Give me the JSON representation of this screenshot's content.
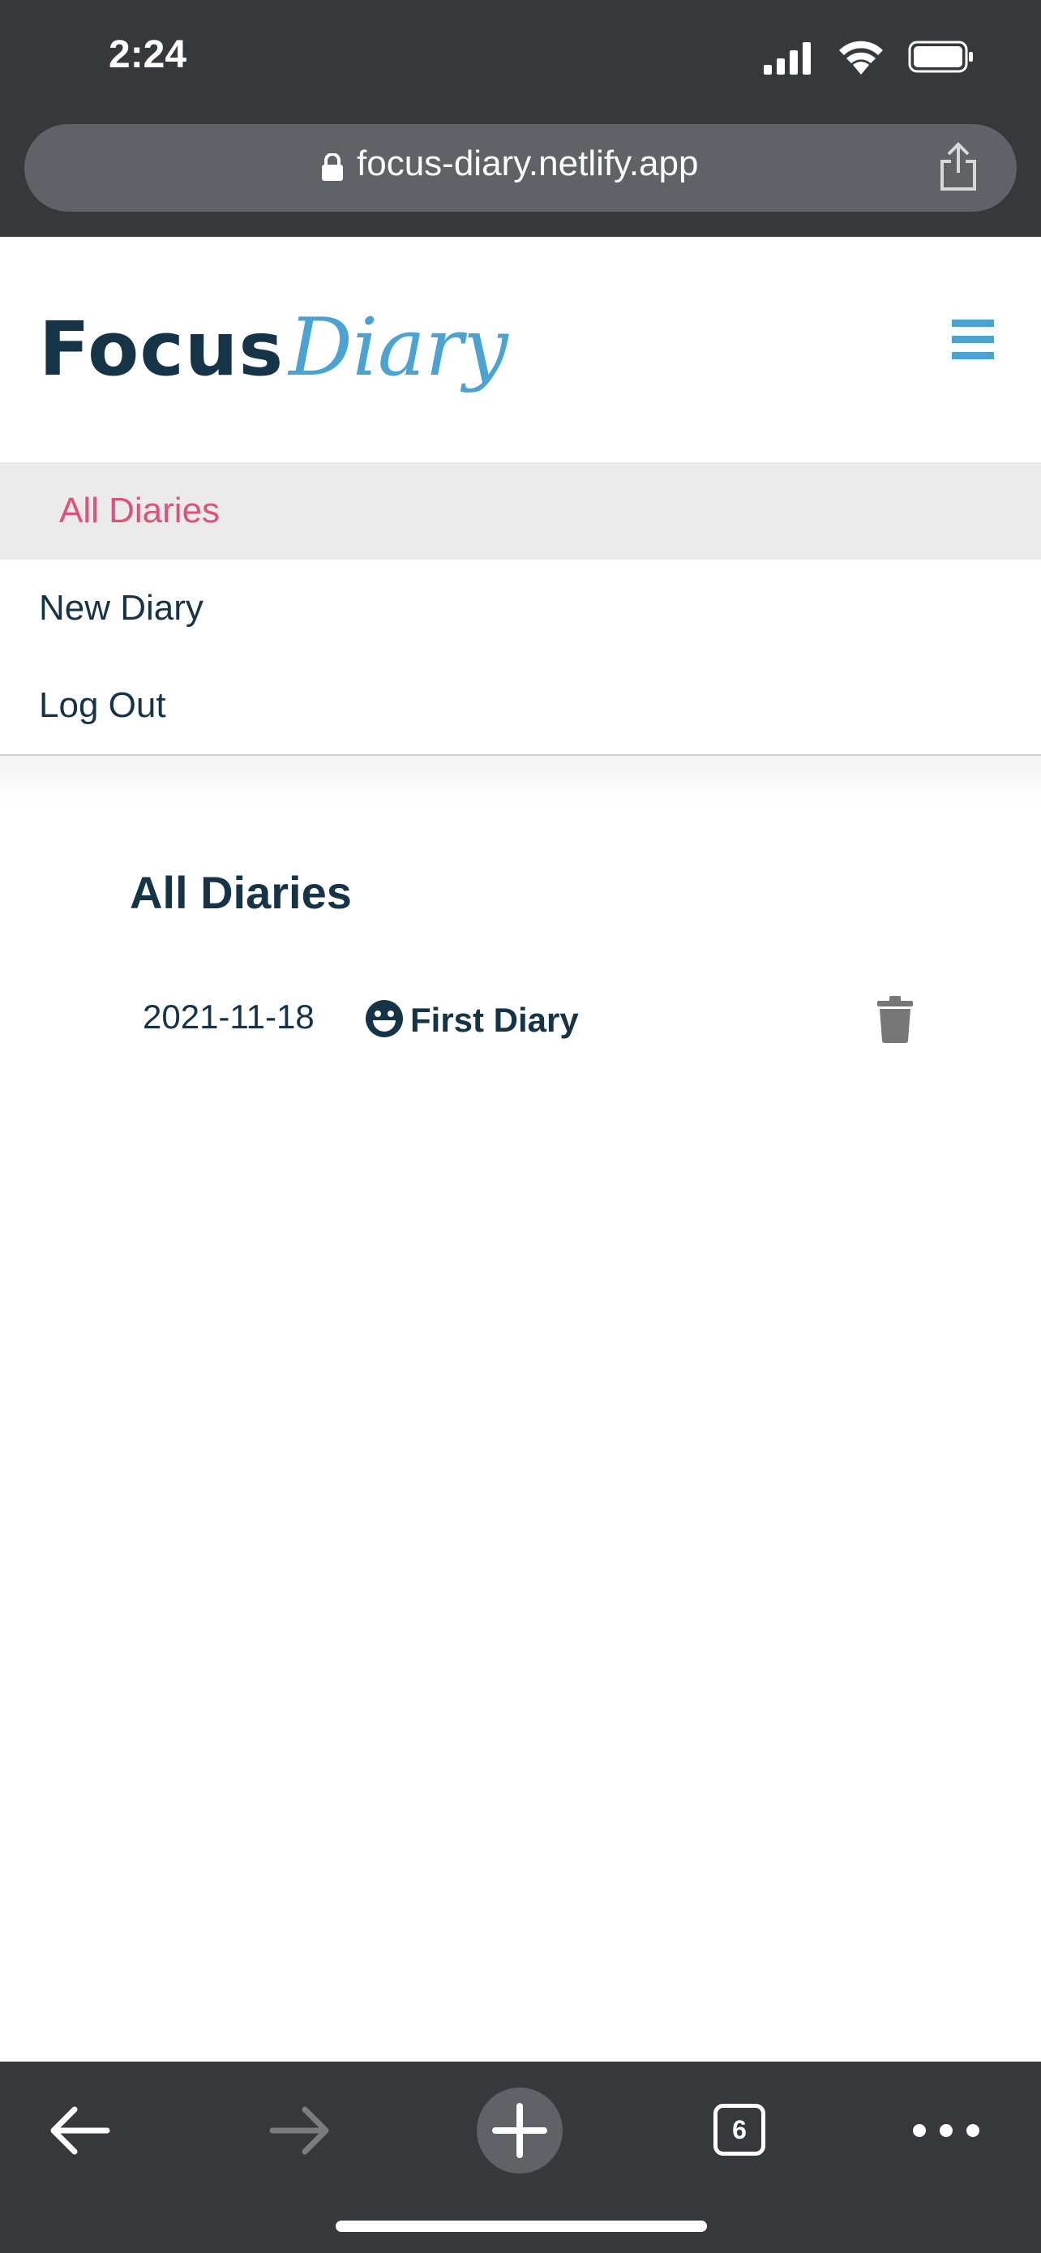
{
  "status_bar": {
    "time": "2:24"
  },
  "browser": {
    "url": "focus-diary.netlify.app",
    "tab_count": "6"
  },
  "header": {
    "logo_main": "Focus",
    "logo_script": "Diary"
  },
  "nav": {
    "items": [
      {
        "label": "All Diaries",
        "active": true
      },
      {
        "label": "New Diary",
        "active": false
      },
      {
        "label": "Log Out",
        "active": false
      }
    ]
  },
  "main": {
    "title": "All Diaries",
    "diaries": [
      {
        "date": "2021-11-18",
        "mood_icon": "grinning-face-icon",
        "title": "First Diary"
      }
    ]
  },
  "colors": {
    "brand_dark": "#163447",
    "brand_blue": "#4aa3d3",
    "active_nav": "#dd5275",
    "browser_chrome": "#36383b"
  }
}
